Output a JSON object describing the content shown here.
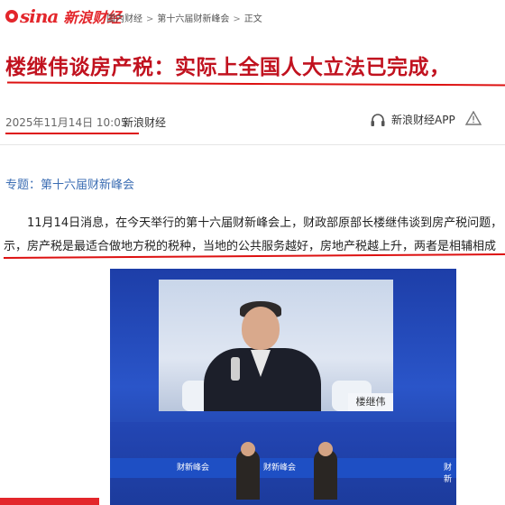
{
  "header": {
    "logo_text": "sina",
    "logo_name": "新浪财经",
    "breadcrumb": [
      "国内财经",
      "第十六届财新峰会",
      "正文"
    ],
    "breadcrumb_sep": ">"
  },
  "article": {
    "title": "楼继伟谈房产税：实际上全国人大立法已完成，",
    "date": "2025年11月14日 10:05",
    "source": "新浪财经",
    "app_link": "新浪财经APP",
    "topic": "专题：第十六届财新峰会",
    "para1": "11月14日消息，在今天举行的第十六届财新峰会上，财政部原部长楼继伟谈到房产税问题，",
    "para2": "示，房产税是最适合做地方税的税种，当地的公共服务越好，房地产税越上升，两者是相辅相成"
  },
  "photo": {
    "nameplate": "楼继伟",
    "stage_brands": [
      "财新峰会",
      "财新峰会",
      "财新"
    ]
  },
  "colors": {
    "brand_red": "#e3262b",
    "title_red": "#c1121f",
    "link_blue": "#3b6db3",
    "annotation_red": "#dd1111"
  },
  "icons": {
    "headphones": "headphones-icon",
    "warning": "warning-icon"
  }
}
